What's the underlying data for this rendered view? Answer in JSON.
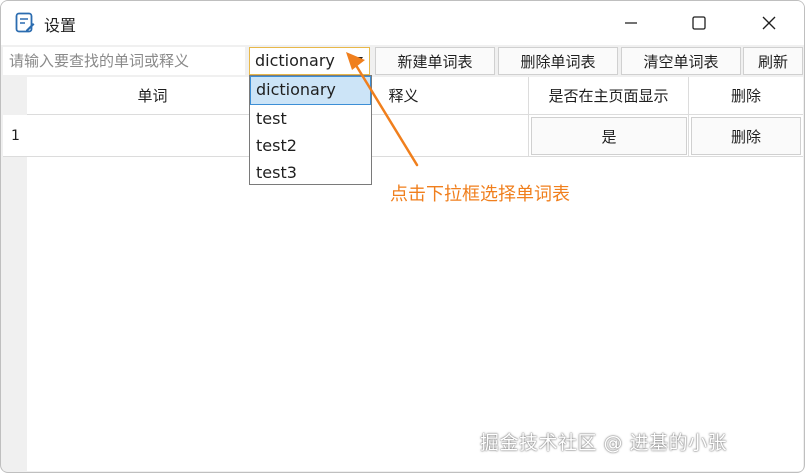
{
  "window": {
    "title": "设置",
    "icon": "notepad-edit-icon",
    "controls": [
      "minimize-icon",
      "maximize-icon",
      "close-icon"
    ]
  },
  "toolbar": {
    "search_placeholder": "请输入要查找的单词或释义",
    "combo_value": "dictionary",
    "new_label": "新建单词表",
    "delete_label": "删除单词表",
    "clear_label": "清空单词表",
    "refresh_label": "刷新"
  },
  "dropdown": {
    "options": [
      "dictionary",
      "test",
      "test2",
      "test3"
    ],
    "selected": "dictionary"
  },
  "table": {
    "columns": [
      "单词",
      "释义",
      "是否在主页面显示",
      "删除"
    ],
    "rows": [
      {
        "index": "1",
        "word": "",
        "definition": "",
        "show_button": "是",
        "delete_button": "删除"
      }
    ]
  },
  "annotation": {
    "text": "点击下拉框选择单词表",
    "color": "#f07f1d"
  },
  "watermark": "掘金技术社区 @ 进基的小张"
}
